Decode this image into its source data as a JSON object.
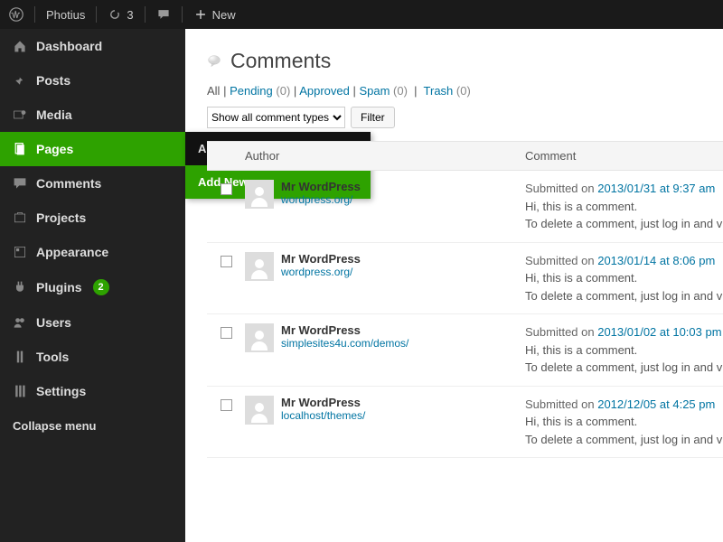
{
  "topbar": {
    "site_name": "Photius",
    "updates_count": "3",
    "new_label": "New"
  },
  "sidebar": {
    "items": [
      {
        "key": "dashboard",
        "label": "Dashboard",
        "icon": "dashboard-icon"
      },
      {
        "key": "posts",
        "label": "Posts",
        "icon": "pin-icon"
      },
      {
        "key": "media",
        "label": "Media",
        "icon": "media-icon"
      },
      {
        "key": "pages",
        "label": "Pages",
        "icon": "pages-icon",
        "active": true
      },
      {
        "key": "comments",
        "label": "Comments",
        "icon": "comment-icon"
      },
      {
        "key": "projects",
        "label": "Projects",
        "icon": "projects-icon"
      },
      {
        "key": "appearance",
        "label": "Appearance",
        "icon": "appearance-icon"
      },
      {
        "key": "plugins",
        "label": "Plugins",
        "icon": "plugins-icon",
        "badge": "2"
      },
      {
        "key": "users",
        "label": "Users",
        "icon": "users-icon"
      },
      {
        "key": "tools",
        "label": "Tools",
        "icon": "tools-icon"
      },
      {
        "key": "settings",
        "label": "Settings",
        "icon": "settings-icon"
      }
    ],
    "collapse_label": "Collapse menu"
  },
  "flyout": {
    "items": [
      {
        "label": "All Pages",
        "selected": false
      },
      {
        "label": "Add New",
        "selected": true
      }
    ]
  },
  "page": {
    "title": "Comments",
    "filters": {
      "all": "All",
      "pending": "Pending",
      "pending_count": "(0)",
      "approved": "Approved",
      "spam": "Spam",
      "spam_count": "(0)",
      "trash": "Trash",
      "trash_count": "(0)"
    },
    "comment_types_option": "Show all comment types",
    "filter_label": "Filter",
    "columns": {
      "author": "Author",
      "comment": "Comment"
    }
  },
  "comments": [
    {
      "author": "Mr WordPress",
      "url": "wordpress.org/",
      "submitted_prefix": "Submitted on ",
      "date": "2013/01/31 at 9:37 am",
      "line1": "Hi, this is a comment.",
      "line2": "To delete a comment, just log in and v"
    },
    {
      "author": "Mr WordPress",
      "url": "wordpress.org/",
      "submitted_prefix": "Submitted on ",
      "date": "2013/01/14 at 8:06 pm",
      "line1": "Hi, this is a comment.",
      "line2": "To delete a comment, just log in and v"
    },
    {
      "author": "Mr WordPress",
      "url": "simplesites4u.com/demos/",
      "submitted_prefix": "Submitted on ",
      "date": "2013/01/02 at 10:03 pm",
      "line1": "Hi, this is a comment.",
      "line2": "To delete a comment, just log in and v"
    },
    {
      "author": "Mr WordPress",
      "url": "localhost/themes/",
      "submitted_prefix": "Submitted on ",
      "date": "2012/12/05 at 4:25 pm",
      "line1": "Hi, this is a comment.",
      "line2": "To delete a comment, just log in and v"
    }
  ]
}
